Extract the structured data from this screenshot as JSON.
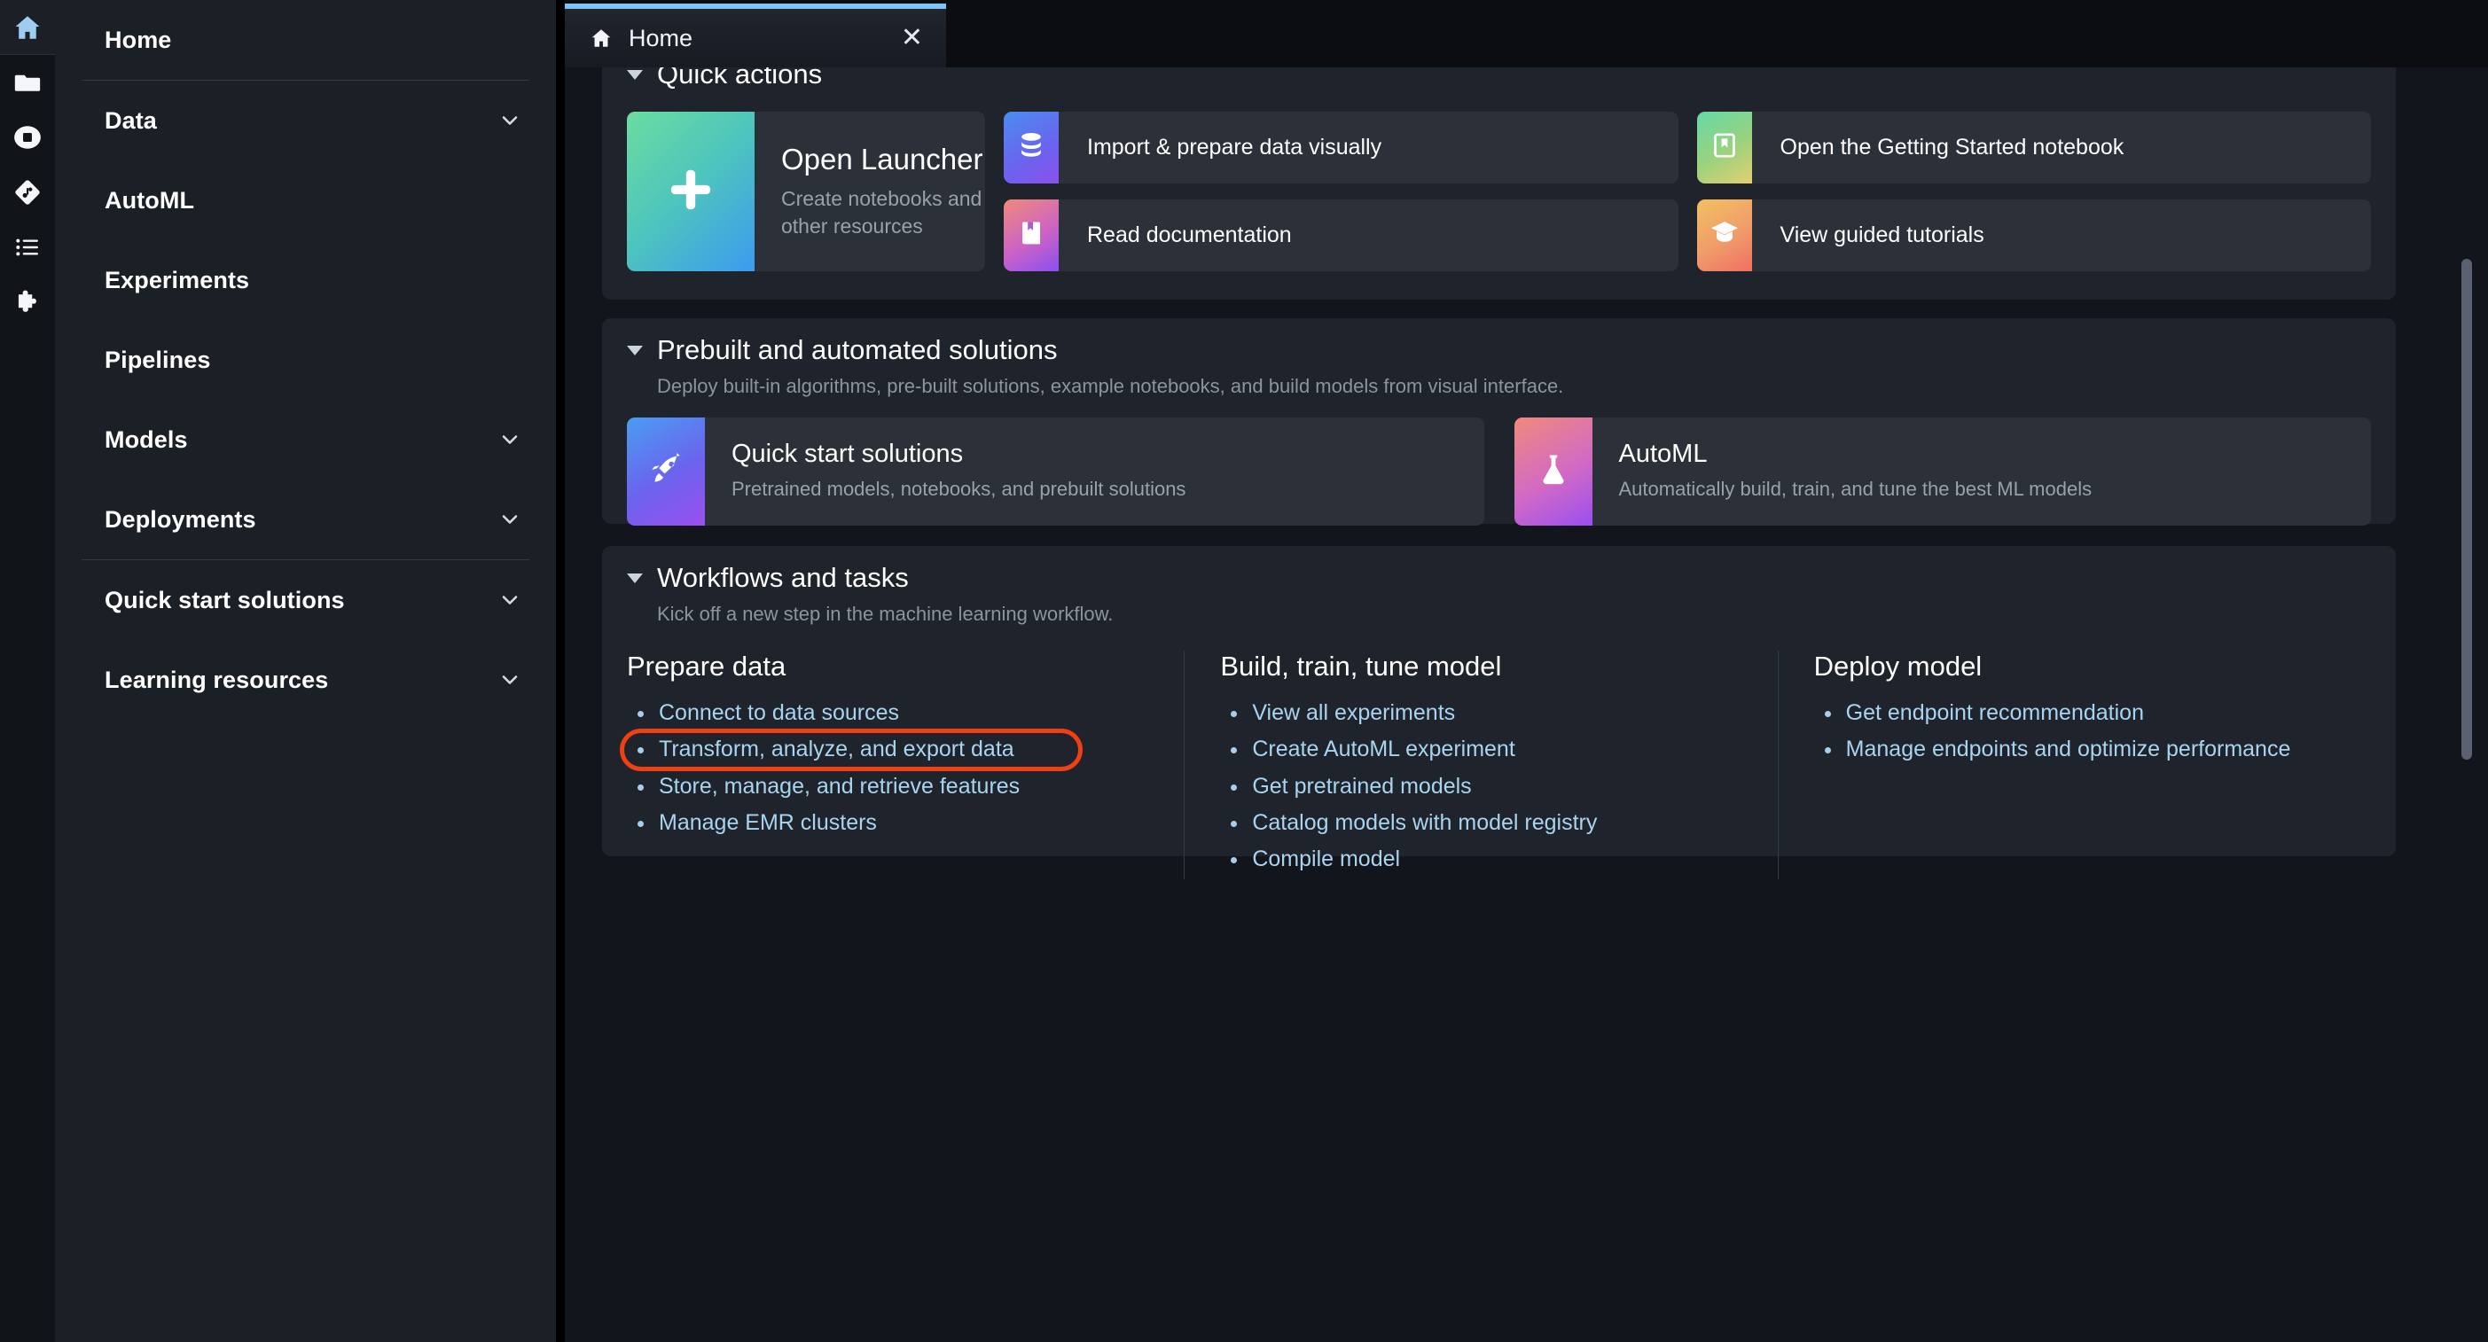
{
  "rail": {
    "items": [
      {
        "icon": "home-icon",
        "name": "rail-item-home",
        "active": true
      },
      {
        "icon": "folder-icon",
        "name": "rail-item-file-browser",
        "active": false
      },
      {
        "icon": "stop-circle-icon",
        "name": "rail-item-running-terminals",
        "active": false
      },
      {
        "icon": "git-icon",
        "name": "rail-item-git",
        "active": false
      },
      {
        "icon": "list-icon",
        "name": "rail-item-table-of-contents",
        "active": false
      },
      {
        "icon": "puzzle-icon",
        "name": "rail-item-extensions",
        "active": false
      }
    ]
  },
  "sidebar": {
    "items": [
      {
        "label": "Home",
        "expandable": false
      },
      {
        "label": "Data",
        "expandable": true
      },
      {
        "label": "AutoML",
        "expandable": false
      },
      {
        "label": "Experiments",
        "expandable": false
      },
      {
        "label": "Pipelines",
        "expandable": false
      },
      {
        "label": "Models",
        "expandable": true
      },
      {
        "label": "Deployments",
        "expandable": true
      },
      {
        "label": "Quick start solutions",
        "expandable": true
      },
      {
        "label": "Learning resources",
        "expandable": true
      }
    ]
  },
  "tab": {
    "label": "Home",
    "close_label": "✕"
  },
  "quick_actions": {
    "title": "Quick actions",
    "launcher": {
      "title": "Open Launcher",
      "subtitle": "Create notebooks and other resources",
      "icon": "plus-icon"
    },
    "cards": [
      {
        "label": "Import & prepare data visually",
        "icon": "database-icon",
        "highlighted": true
      },
      {
        "label": "Read documentation",
        "icon": "book-icon",
        "highlighted": false
      },
      {
        "label": "Open the Getting Started notebook",
        "icon": "bookmark-icon",
        "highlighted": false
      },
      {
        "label": "View guided tutorials",
        "icon": "graduation-cap-icon",
        "highlighted": false
      }
    ]
  },
  "prebuilt": {
    "title": "Prebuilt and automated solutions",
    "subtitle": "Deploy built-in algorithms, pre-built solutions, example notebooks, and build models from visual interface.",
    "cards": [
      {
        "title": "Quick start solutions",
        "subtitle": "Pretrained models, notebooks, and prebuilt solutions",
        "icon": "rocket-icon"
      },
      {
        "title": "AutoML",
        "subtitle": "Automatically build, train, and tune the best ML models",
        "icon": "flask-icon"
      }
    ]
  },
  "workflows": {
    "title": "Workflows and tasks",
    "subtitle": "Kick off a new step in the machine learning workflow.",
    "columns": [
      {
        "title": "Prepare data",
        "links": [
          {
            "label": "Connect to data sources",
            "highlighted": false
          },
          {
            "label": "Transform, analyze, and export data",
            "highlighted": true
          },
          {
            "label": "Store, manage, and retrieve features",
            "highlighted": false
          },
          {
            "label": "Manage EMR clusters",
            "highlighted": false
          }
        ]
      },
      {
        "title": "Build, train, tune model",
        "links": [
          {
            "label": "View all experiments",
            "highlighted": false
          },
          {
            "label": "Create AutoML experiment",
            "highlighted": false
          },
          {
            "label": "Get pretrained models",
            "highlighted": false
          },
          {
            "label": "Catalog models with model registry",
            "highlighted": false
          },
          {
            "label": "Compile model",
            "highlighted": false
          }
        ]
      },
      {
        "title": "Deploy model",
        "links": [
          {
            "label": "Get endpoint recommendation",
            "highlighted": false
          },
          {
            "label": "Manage endpoints and optimize performance",
            "highlighted": false
          }
        ]
      }
    ]
  },
  "colors": {
    "highlight": "#ef4014",
    "link": "#a9d4f0",
    "tab_accent": "#7fc4f7",
    "panel_bg": "#1f232b",
    "card_bg": "#2b3039"
  }
}
